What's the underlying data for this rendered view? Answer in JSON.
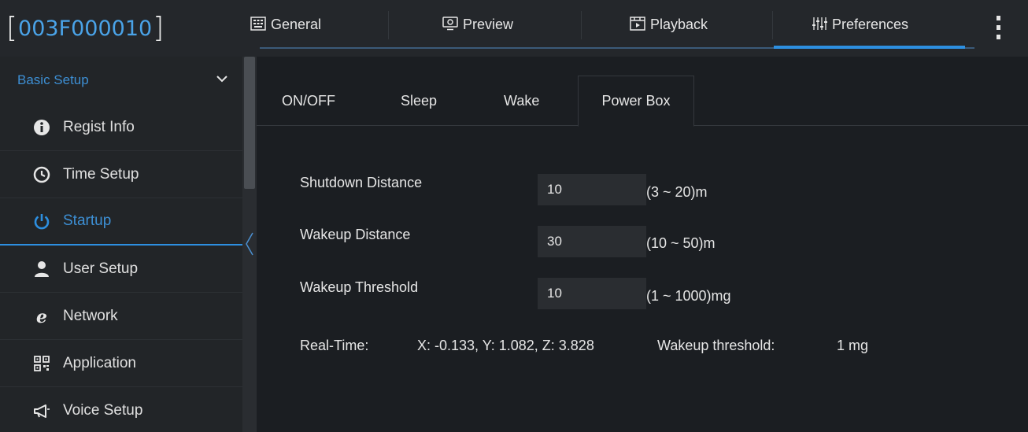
{
  "header": {
    "device_id": "003F000010",
    "bracket_open": "[",
    "bracket_close": "]",
    "tabs": [
      {
        "label": "General",
        "icon": "keyboard-icon"
      },
      {
        "label": "Preview",
        "icon": "monitor-icon"
      },
      {
        "label": "Playback",
        "icon": "film-icon"
      },
      {
        "label": "Preferences",
        "icon": "sliders-icon"
      }
    ],
    "active_tab": "Preferences",
    "menu_icon": "more-vertical-icon"
  },
  "sidebar": {
    "section_title": "Basic Setup",
    "section_icon": "chevron-down-icon",
    "items": [
      {
        "label": "Regist Info",
        "icon": "info-icon"
      },
      {
        "label": "Time Setup",
        "icon": "clock-icon"
      },
      {
        "label": "Startup",
        "icon": "power-icon",
        "active": true
      },
      {
        "label": "User Setup",
        "icon": "user-icon"
      },
      {
        "label": "Network",
        "icon": "ie-icon"
      },
      {
        "label": "Application",
        "icon": "qr-icon"
      },
      {
        "label": "Voice Setup",
        "icon": "megaphone-icon"
      }
    ]
  },
  "main": {
    "tabs": [
      {
        "label": "ON/OFF"
      },
      {
        "label": "Sleep"
      },
      {
        "label": "Wake"
      },
      {
        "label": "Power Box",
        "active": true
      }
    ],
    "fields": [
      {
        "label": "Shutdown Distance",
        "value": "10",
        "range": "(3 ~ 20)m"
      },
      {
        "label": "Wakeup Distance",
        "value": "30",
        "range": "(10 ~ 50)m"
      },
      {
        "label": "Wakeup Threshold",
        "value": "10",
        "range": "(1 ~ 1000)mg"
      }
    ],
    "realtime": {
      "label": "Real-Time:",
      "value": "X: -0.133, Y: 1.082, Z: 3.828",
      "threshold_label": "Wakeup threshold:",
      "threshold_value": "1 mg"
    }
  },
  "colors": {
    "accent": "#2d8fe0",
    "device_id": "#4aa3e8",
    "background": "#1b1e22",
    "sidebar": "#222528"
  }
}
